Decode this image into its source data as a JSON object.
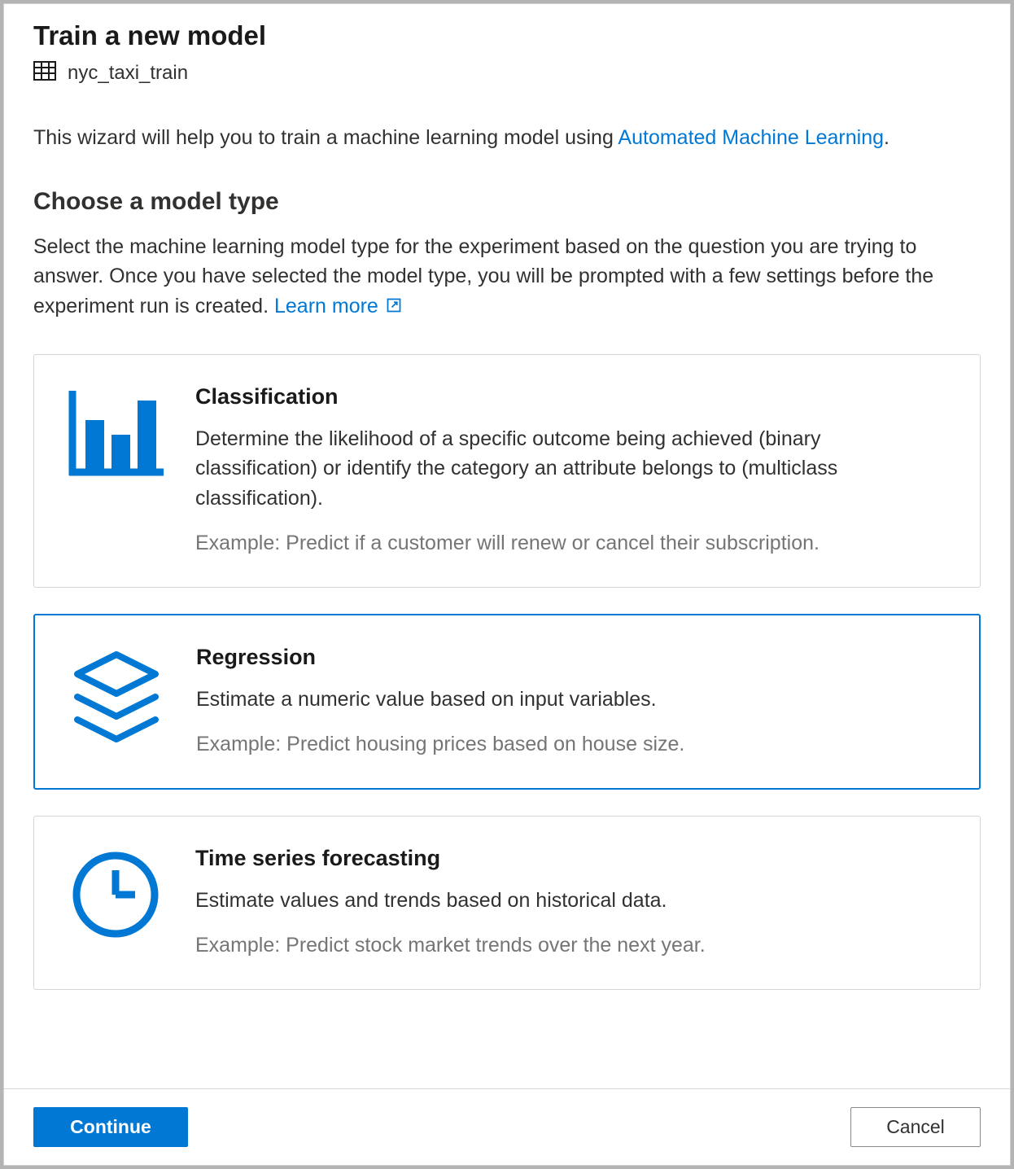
{
  "page_title": "Train a new model",
  "dataset_name": "nyc_taxi_train",
  "intro": {
    "prefix": "This wizard will help you to train a machine learning model using ",
    "link": "Automated Machine Learning",
    "suffix": "."
  },
  "section": {
    "title": "Choose a model type",
    "desc_prefix": "Select the machine learning model type for the experiment based on the question you are trying to answer. Once you have selected the model type, you will be prompted with a few settings before the experiment run is created. ",
    "learn_more": "Learn more"
  },
  "cards": [
    {
      "id": "classification",
      "title": "Classification",
      "desc": "Determine the likelihood of a specific outcome being achieved (binary classification) or identify the category an attribute belongs to (multiclass classification).",
      "example": "Example: Predict if a customer will renew or cancel their subscription.",
      "selected": false
    },
    {
      "id": "regression",
      "title": "Regression",
      "desc": "Estimate a numeric value based on input variables.",
      "example": "Example: Predict housing prices based on house size.",
      "selected": true
    },
    {
      "id": "forecasting",
      "title": "Time series forecasting",
      "desc": "Estimate values and trends based on historical data.",
      "example": "Example: Predict stock market trends over the next year.",
      "selected": false
    }
  ],
  "footer": {
    "continue": "Continue",
    "cancel": "Cancel"
  },
  "colors": {
    "accent": "#0078d4"
  }
}
